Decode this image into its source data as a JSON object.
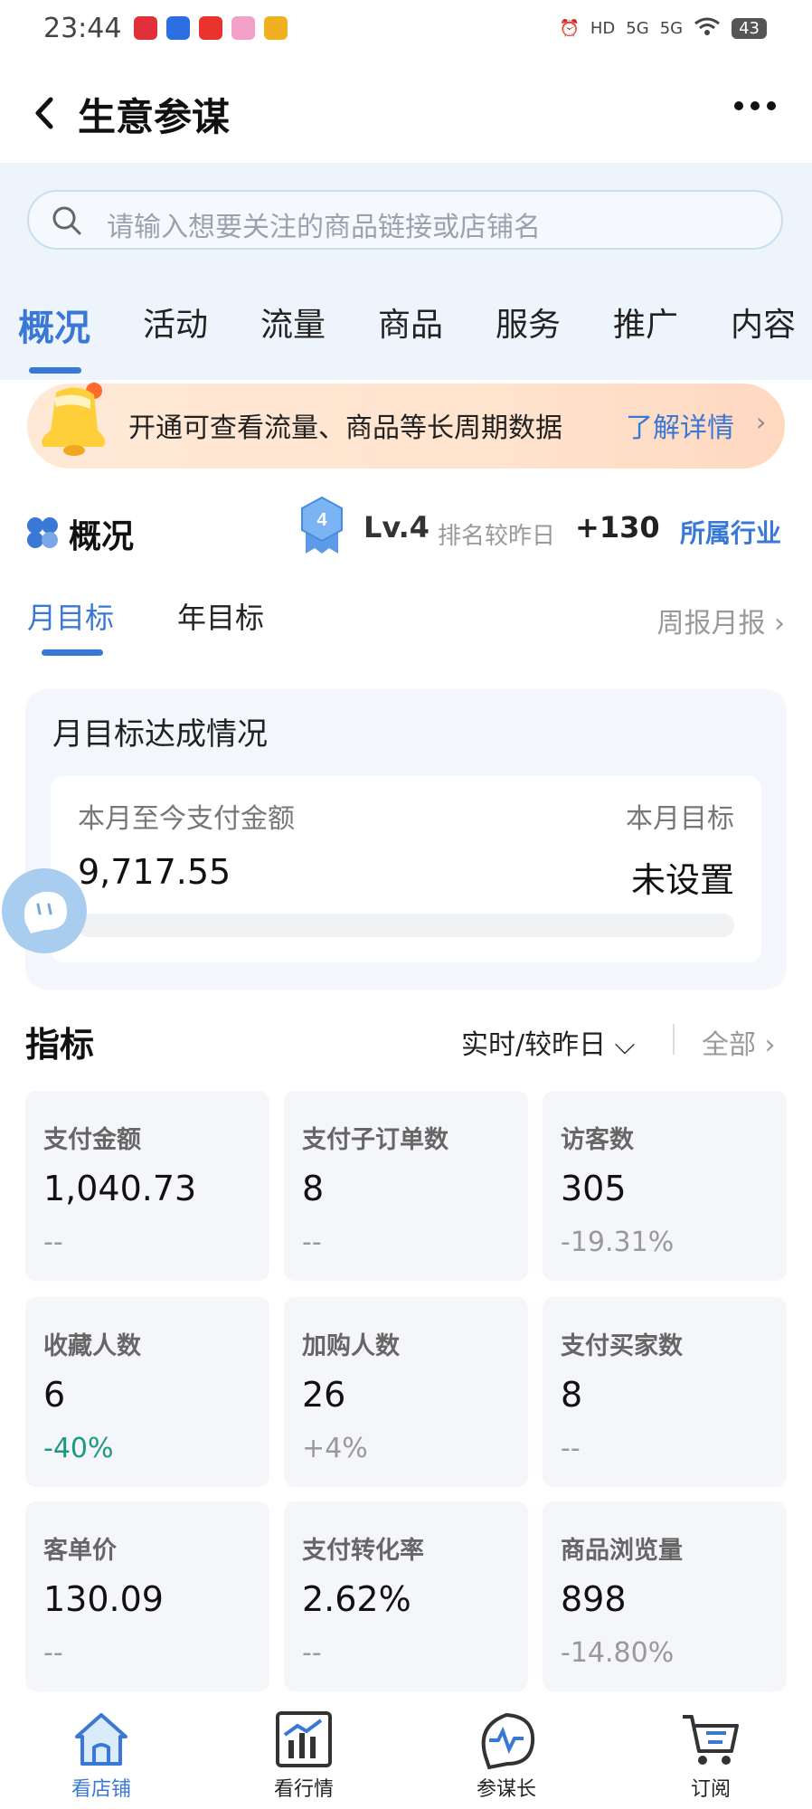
{
  "status_bar": {
    "time": "23:44",
    "hd": "HD",
    "signal1": "5G",
    "signal2": "5G",
    "battery": "43"
  },
  "header": {
    "title": "生意参谋"
  },
  "search": {
    "placeholder": "请输入想要关注的商品链接或店铺名"
  },
  "tabs": [
    "概况",
    "活动",
    "流量",
    "商品",
    "服务",
    "推广",
    "内容"
  ],
  "promo": {
    "text": "开通可查看流量、商品等长周期数据",
    "link": "了解详情",
    "chevron": "›"
  },
  "overview": {
    "title": "概况",
    "level_badge": "4",
    "level": "Lv.4",
    "rank_label": "排名较昨日",
    "rank_value": "+130",
    "industry_link": "所属行业"
  },
  "goal_tabs": {
    "month": "月目标",
    "year": "年目标",
    "report": "周报月报 ›"
  },
  "goal_card": {
    "title": "月目标达成情况",
    "pay_label": "本月至今支付金额",
    "pay_value": "9,717.55",
    "target_label": "本月目标",
    "target_value": "未设置",
    "progress": 0
  },
  "metrics": {
    "title": "指标",
    "selector": "实时/较昨日 ⌵",
    "all_link": "全部 ›",
    "items": [
      {
        "label": "支付金额",
        "value": "1,040.73",
        "change": "--"
      },
      {
        "label": "支付子订单数",
        "value": "8",
        "change": "--"
      },
      {
        "label": "访客数",
        "value": "305",
        "change": "-19.31%"
      },
      {
        "label": "收藏人数",
        "value": "6",
        "change": "-40%"
      },
      {
        "label": "加购人数",
        "value": "26",
        "change": "+4%"
      },
      {
        "label": "支付买家数",
        "value": "8",
        "change": "--"
      },
      {
        "label": "客单价",
        "value": "130.09",
        "change": "--"
      },
      {
        "label": "支付转化率",
        "value": "2.62%",
        "change": "--"
      },
      {
        "label": "商品浏览量",
        "value": "898",
        "change": "-14.80%"
      }
    ]
  },
  "bottom_nav": [
    {
      "label": "看店铺",
      "icon": "shop-icon",
      "active": true
    },
    {
      "label": "看行情",
      "icon": "market-chart-icon",
      "active": false
    },
    {
      "label": "参谋长",
      "icon": "advisor-icon",
      "active": false
    },
    {
      "label": "订阅",
      "icon": "cart-icon",
      "active": false
    }
  ],
  "colors": {
    "accent": "#3a78d6",
    "down": "#1b9a82"
  }
}
